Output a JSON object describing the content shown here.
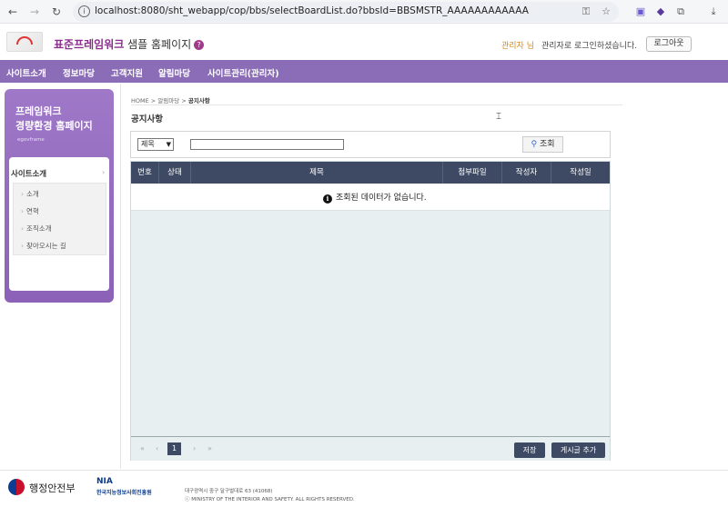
{
  "browser": {
    "url": "localhost:8080/sht_webapp/cop/bbs/selectBoardList.do?bbsId=BBSMSTR_AAAAAAAAAAAA",
    "profile_badge": "5"
  },
  "header": {
    "title_accent": "표준프레임워크",
    "title_rest": " 샘플 홈페이지",
    "help": "?",
    "admin_name": "관리자 님",
    "login_msg": "관리자로 로그인하셨습니다.",
    "logout": "로그아웃"
  },
  "menu": [
    "사이트소개",
    "정보마당",
    "고객지원",
    "알림마당",
    "사이트관리(관리자)"
  ],
  "sidebar": {
    "title_line1": "프레임워크",
    "title_line2": "경량환경 홈페이지",
    "subtitle": "egovframe",
    "section": "사이트소개",
    "items": [
      "소개",
      "연혁",
      "조직소개",
      "찾아오시는 길"
    ]
  },
  "breadcrumb": {
    "home": "HOME",
    "mid": "알림마당",
    "current": "공지사항"
  },
  "page_title": "공지사항",
  "search": {
    "select_value": "제목",
    "input_value": "",
    "button": "조회"
  },
  "table": {
    "columns": [
      "번호",
      "상태",
      "제목",
      "첨부파일",
      "작성자",
      "작성일"
    ],
    "empty_message": "조회된 데이터가 없습니다."
  },
  "pager": {
    "first": "«",
    "prev": "‹",
    "current": "1",
    "next": "›",
    "last": "»"
  },
  "buttons": {
    "save": "저장",
    "add_post": "게시글 추가"
  },
  "footer": {
    "gov_name": "행정안전부",
    "nia": "NIA",
    "nia_name": "한국지능정보사회진흥원",
    "address": "대구광역시 중구 달구벌대로 63 (41068)",
    "copyright": "ⓒ MINISTRY OF THE INTERIOR AND SAFETY. ALL RIGHTS RESERVED."
  },
  "colors": {
    "menu_bg": "#8b6cb7",
    "table_header_bg": "#3e4a63",
    "accent": "#8a2f8c",
    "admin_name": "#d28a1e"
  }
}
